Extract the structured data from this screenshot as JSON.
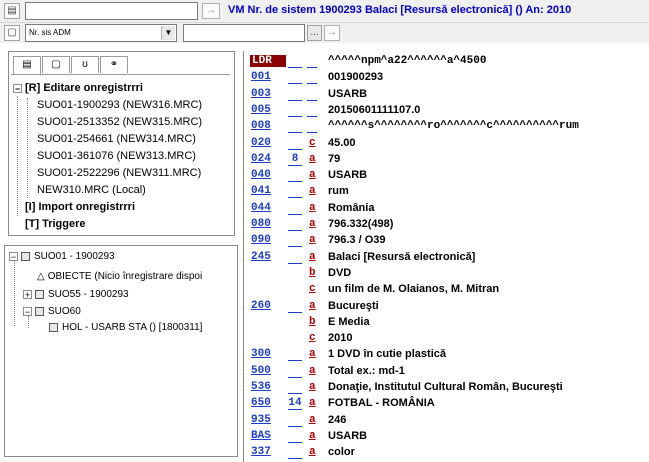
{
  "toolbar1": {
    "title": "VM Nr. de sistem 1900293 Balaci [Resursă electronică] () An: 2010",
    "go_icon": "arrow-right-icon"
  },
  "toolbar2": {
    "combo_value": "Nr. sis ADM",
    "ellipsis_label": "..."
  },
  "tree": {
    "tabs": [
      "page-icon",
      "window-icon",
      "tag-icon",
      "binoculars-icon"
    ],
    "nodes": [
      {
        "label": "[R] Editare onregistrrri",
        "bold": true,
        "expander": "−"
      },
      {
        "label": "SUO01-1900293 (NEW316.MRC)",
        "selected": true
      },
      {
        "label": "SUO01-2513352 (NEW315.MRC)"
      },
      {
        "label": "SUO01-254661 (NEW314.MRC)"
      },
      {
        "label": "SUO01-361076 (NEW313.MRC)"
      },
      {
        "label": "SUO01-2522296 (NEW311.MRC)"
      },
      {
        "label": "NEW310.MRC (Local)"
      },
      {
        "label": "[I] Import onregistrrri",
        "bold": true
      },
      {
        "label": "[T] Triggere",
        "bold": true
      }
    ]
  },
  "records": {
    "nodes": [
      {
        "label": "SUO01 - 1900293"
      },
      {
        "label": "OBIECTE (Nicio înregistrare dispoi"
      },
      {
        "label": "SUO55 - 1900293"
      },
      {
        "label": "SUO60"
      },
      {
        "label": "HOL - USARB STA () [1800311]"
      }
    ]
  },
  "marc": [
    {
      "tag": "LDR",
      "ind1": "",
      "sub": "",
      "value": "^^^^^npm^a22^^^^^^a^4500",
      "mono": true
    },
    {
      "tag": "001",
      "ind1": "",
      "sub": "",
      "value": "001900293"
    },
    {
      "tag": "003",
      "ind1": "",
      "sub": "",
      "value": "USARB"
    },
    {
      "tag": "005",
      "ind1": "",
      "sub": "",
      "value": "20150601111107.0"
    },
    {
      "tag": "008",
      "ind1": "",
      "sub": "",
      "value": "^^^^^^s^^^^^^^^ro^^^^^^^c^^^^^^^^^^rum",
      "mono": true
    },
    {
      "tag": "020",
      "ind1": "",
      "sub": "c",
      "value": "45.00"
    },
    {
      "tag": "024",
      "ind1": "8",
      "sub": "a",
      "value": "79"
    },
    {
      "tag": "040",
      "ind1": "",
      "sub": "a",
      "value": "USARB"
    },
    {
      "tag": "041",
      "ind1": "",
      "sub": "a",
      "value": "rum"
    },
    {
      "tag": "044",
      "ind1": "",
      "sub": "a",
      "value": "România"
    },
    {
      "tag": "080",
      "ind1": "",
      "sub": "a",
      "value": "796.332(498)"
    },
    {
      "tag": "090",
      "ind1": "",
      "sub": "a",
      "value": "796.3 / O39"
    },
    {
      "tag": "245",
      "ind1": "",
      "sub": "a",
      "value": "Balaci [Resursă electronică]"
    },
    {
      "tag": "",
      "ind1": "",
      "sub": "b",
      "value": "DVD"
    },
    {
      "tag": "",
      "ind1": "",
      "sub": "c",
      "value": "un film de M. Olaianos, M. Mitran"
    },
    {
      "tag": "260",
      "ind1": "",
      "sub": "a",
      "value": "Bucureşti"
    },
    {
      "tag": "",
      "ind1": "",
      "sub": "b",
      "value": "E Media"
    },
    {
      "tag": "",
      "ind1": "",
      "sub": "c",
      "value": "2010"
    },
    {
      "tag": "300",
      "ind1": "",
      "sub": "a",
      "value": "1 DVD în cutie plastică"
    },
    {
      "tag": "500",
      "ind1": "",
      "sub": "a",
      "value": "Total ex.: md-1"
    },
    {
      "tag": "536",
      "ind1": "",
      "sub": "a",
      "value": "Donaţie, Institutul Cultural Român, Bucureşti"
    },
    {
      "tag": "650",
      "ind1": "14",
      "sub": "a",
      "value": "FOTBAL - ROMÂNIA"
    },
    {
      "tag": "935",
      "ind1": "",
      "sub": "a",
      "value": "246"
    },
    {
      "tag": "BAS",
      "ind1": "",
      "sub": "a",
      "value": "USARB"
    },
    {
      "tag": "337",
      "ind1": "",
      "sub": "a",
      "value": "color"
    }
  ]
}
